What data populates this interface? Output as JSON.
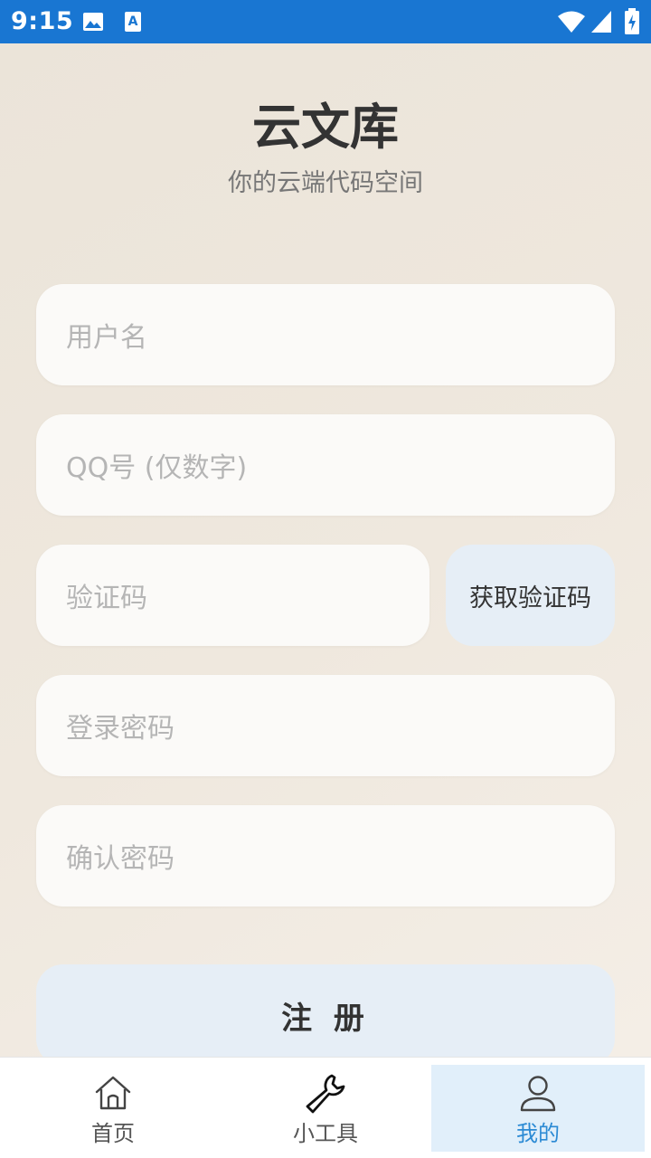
{
  "status_bar": {
    "time": "9:15",
    "icons": [
      "image-icon",
      "text-a-icon",
      "wifi-icon",
      "signal-icon",
      "battery-charging-icon"
    ]
  },
  "header": {
    "title": "云文库",
    "subtitle": "你的云端代码空间"
  },
  "form": {
    "username_placeholder": "用户名",
    "qq_placeholder": "QQ号 (仅数字)",
    "code_placeholder": "验证码",
    "get_code_label": "获取验证码",
    "password_placeholder": "登录密码",
    "confirm_password_placeholder": "确认密码",
    "register_label": "注 册"
  },
  "tabbar": {
    "items": [
      {
        "label": "首页",
        "icon": "home-icon"
      },
      {
        "label": "小工具",
        "icon": "wrench-icon"
      },
      {
        "label": "我的",
        "icon": "user-icon",
        "active": true
      }
    ]
  },
  "colors": {
    "status_bar": "#1976d2",
    "accent": "#2b8ad4",
    "button_bg": "#e6eef6",
    "field_bg": "#fbfaf8"
  }
}
